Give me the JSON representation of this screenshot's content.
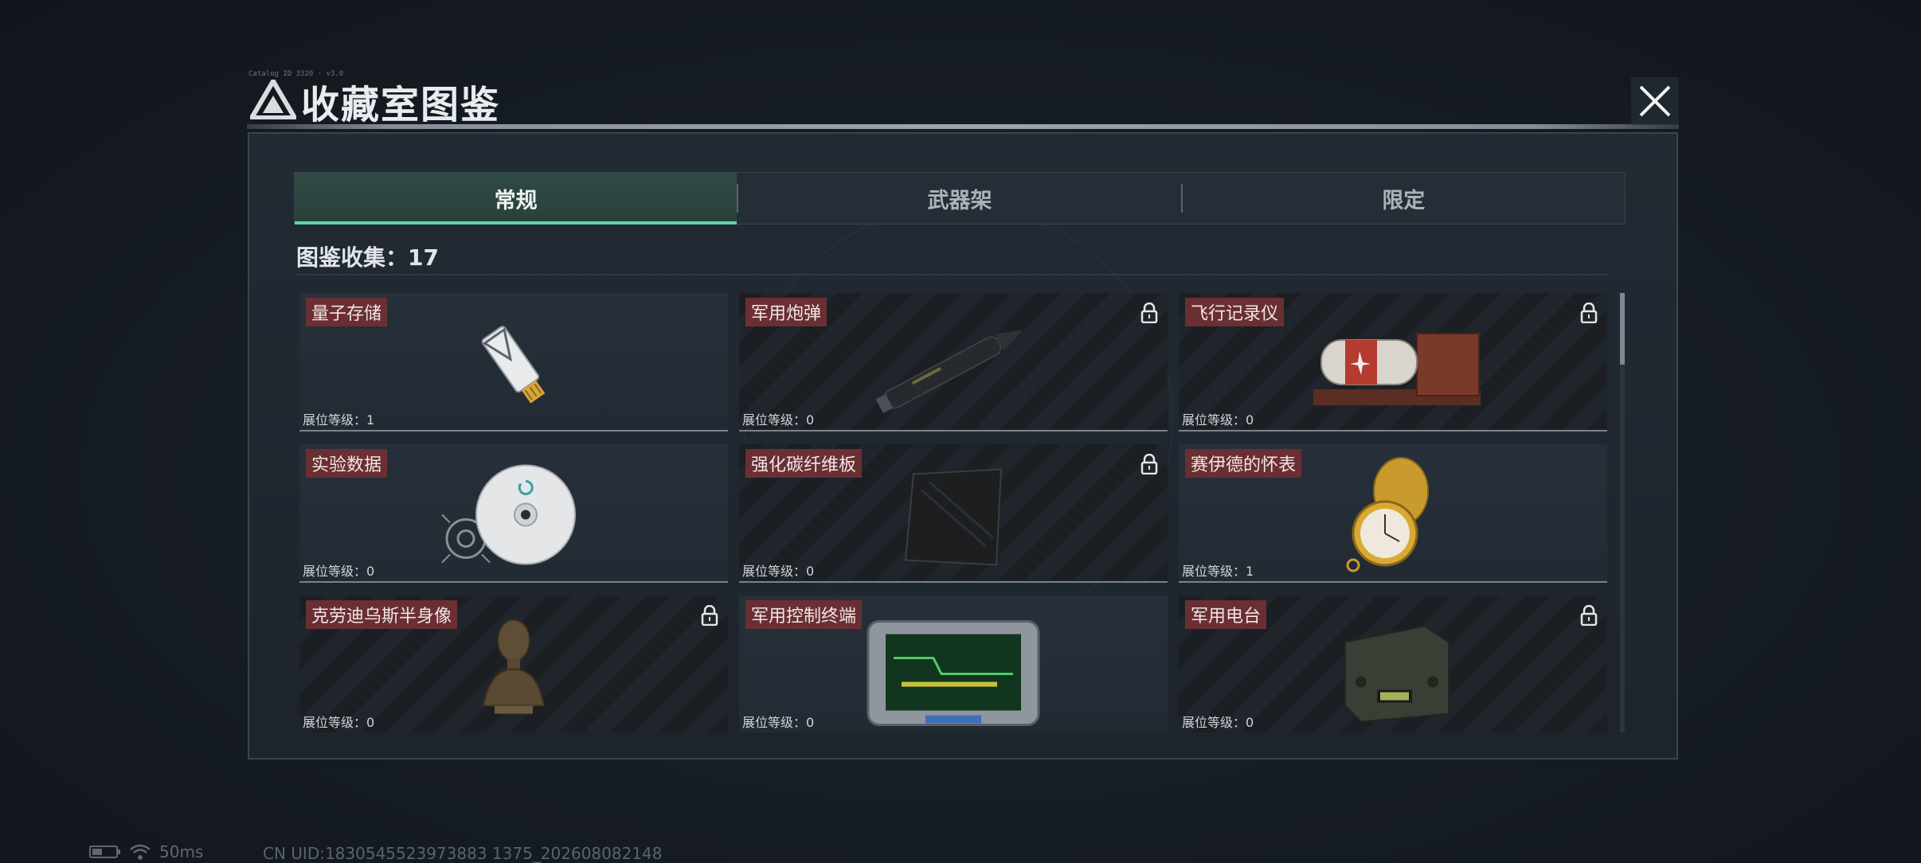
{
  "dialog": {
    "title": "收藏室图鉴",
    "tiny_caption": "Catalog ID 3320 · v3.0",
    "close_icon": "close-icon"
  },
  "tabs": [
    {
      "label": "常规",
      "active": true
    },
    {
      "label": "武器架",
      "active": false
    },
    {
      "label": "限定",
      "active": false
    }
  ],
  "collection": {
    "label": "图鉴收集：17"
  },
  "items": [
    {
      "name": "量子存储",
      "level": "展位等级：1",
      "locked": false,
      "owned": true,
      "icon": "usb-drive-icon"
    },
    {
      "name": "军用炮弹",
      "level": "展位等级：0",
      "locked": true,
      "owned": false,
      "icon": "artillery-shell-icon"
    },
    {
      "name": "飞行记录仪",
      "level": "展位等级：0",
      "locked": true,
      "owned": false,
      "icon": "flight-recorder-icon"
    },
    {
      "name": "实验数据",
      "level": "展位等级：0",
      "locked": false,
      "owned": true,
      "icon": "disc-icon"
    },
    {
      "name": "强化碳纤维板",
      "level": "展位等级：0",
      "locked": true,
      "owned": false,
      "icon": "carbon-plate-icon"
    },
    {
      "name": "赛伊德的怀表",
      "level": "展位等级：1",
      "locked": false,
      "owned": true,
      "icon": "pocket-watch-icon"
    },
    {
      "name": "克劳迪乌斯半身像",
      "level": "展位等级：0",
      "locked": true,
      "owned": false,
      "icon": "bust-icon"
    },
    {
      "name": "军用控制终端",
      "level": "展位等级：0",
      "locked": false,
      "owned": true,
      "icon": "control-terminal-icon"
    },
    {
      "name": "军用电台",
      "level": "展位等级：0",
      "locked": true,
      "owned": false,
      "icon": "radio-icon"
    }
  ],
  "status_bar": {
    "ping": "50ms",
    "uid": "CN UID:1830545523973883 1375_202608082148"
  },
  "colors": {
    "accent_green": "#5fd6a4",
    "label_red": "#6a2f33",
    "panel": "#1d242c"
  }
}
